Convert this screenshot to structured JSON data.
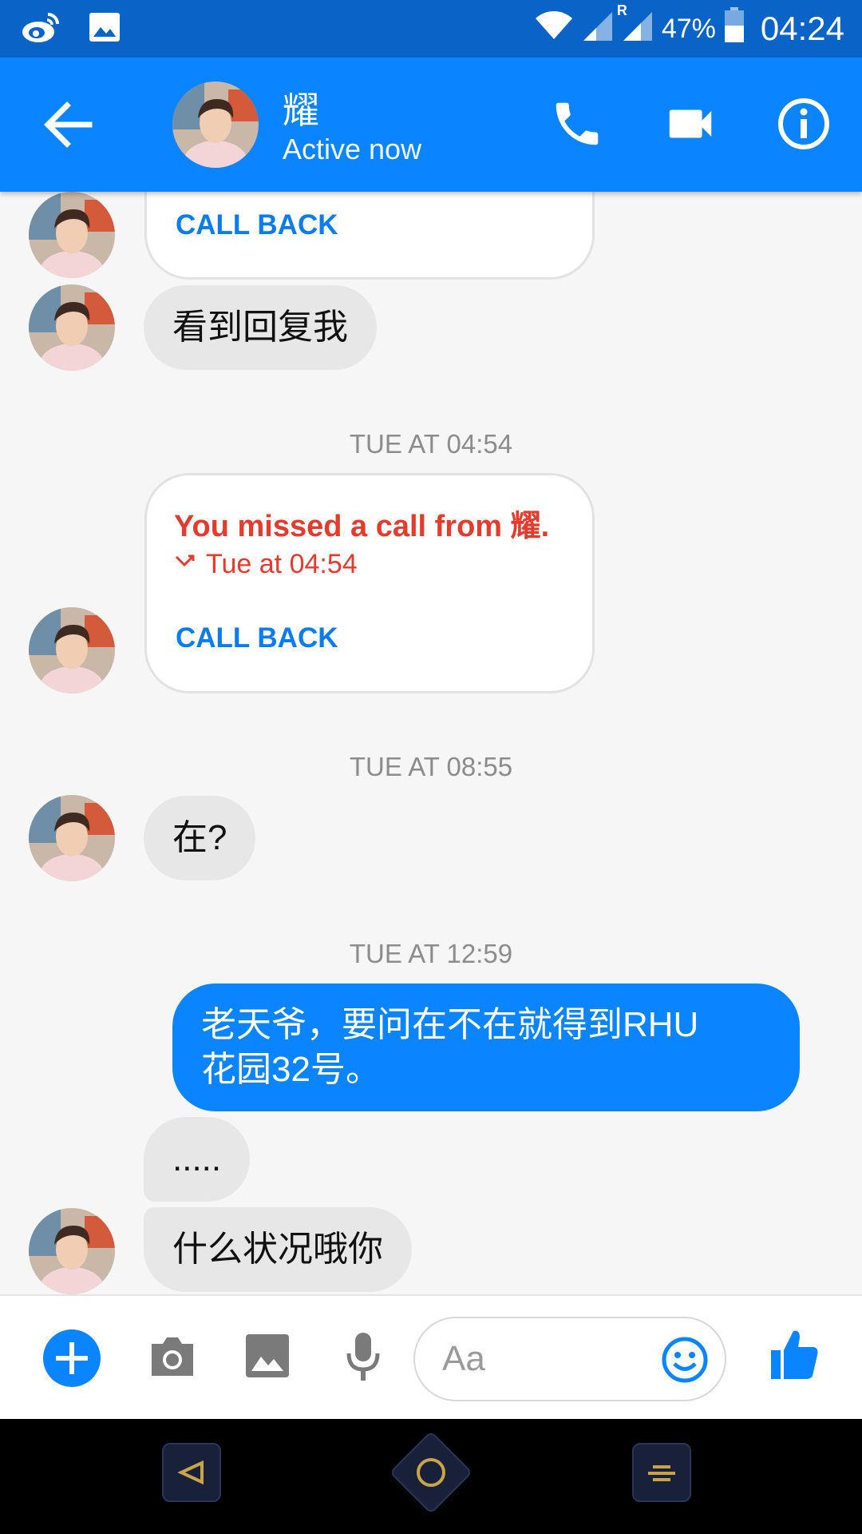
{
  "status_bar": {
    "battery": "47%",
    "time": "04:24",
    "roaming": "R"
  },
  "header": {
    "name": "耀",
    "presence": "Active now"
  },
  "conversation": {
    "call_back_label": "CALL BACK",
    "msg_1": "看到回复我",
    "timestamp_1": "TUE AT 04:54",
    "missed_call": {
      "title": "You missed a call from 耀.",
      "time": "Tue at 04:54"
    },
    "timestamp_2": "TUE AT 08:55",
    "msg_2": "在?",
    "timestamp_3": "TUE AT 12:59",
    "msg_out_line1": "老天爷，要问在不在就得到RHU",
    "msg_out_line2": "花园32号。",
    "msg_3": ".....",
    "msg_4": "什么状况哦你"
  },
  "composer": {
    "placeholder": "Aa"
  },
  "colors": {
    "brand": "#0a84ff",
    "status_bar": "#0a63c7",
    "missed": "#e53b2d",
    "bubble_in": "#e7e7e7"
  }
}
